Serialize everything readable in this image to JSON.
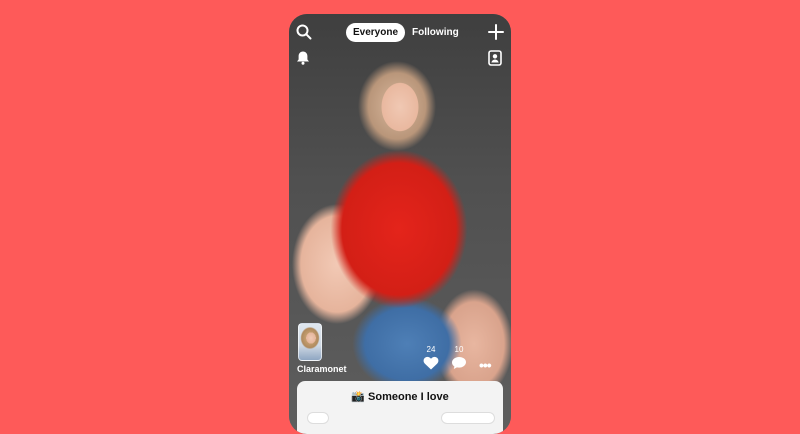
{
  "header": {
    "tabs": [
      {
        "label": "Everyone",
        "active": true
      },
      {
        "label": "Following",
        "active": false
      }
    ]
  },
  "post": {
    "username": "Claramonet",
    "likes": "24",
    "comments": "10",
    "caption": "Someone I love",
    "caption_emoji": "📸"
  },
  "colors": {
    "background": "#fe5a59",
    "accent_white": "#ffffff"
  },
  "icons": {
    "search": "search-icon",
    "add": "plus-icon",
    "notifications": "bell-icon",
    "profile": "profile-icon",
    "like": "heart-icon",
    "comment": "comment-icon",
    "more": "more-icon"
  }
}
